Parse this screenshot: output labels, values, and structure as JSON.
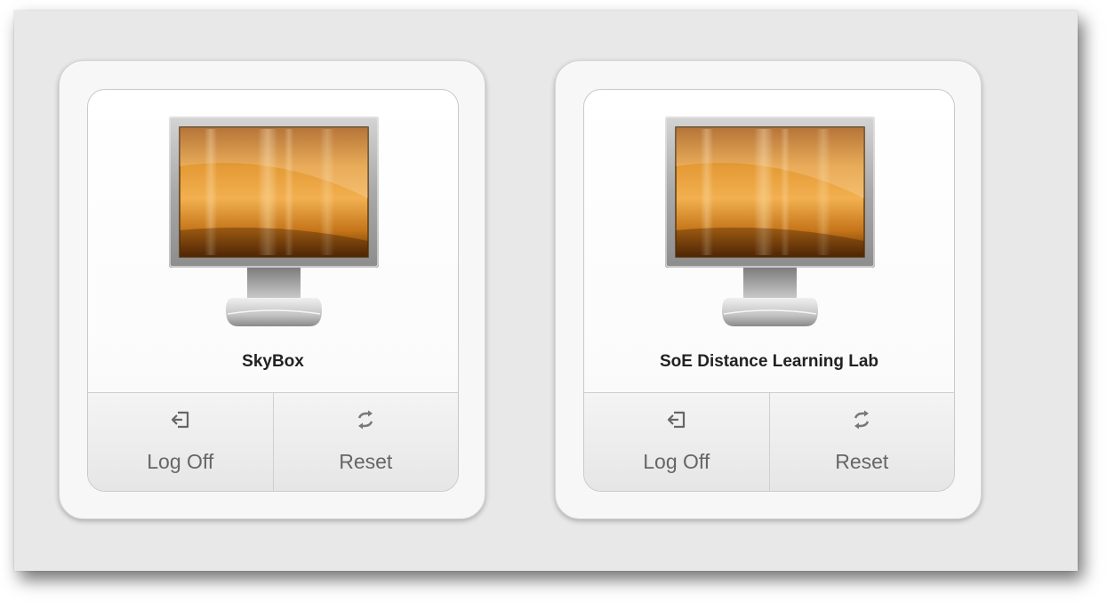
{
  "desktops": [
    {
      "name": "SkyBox",
      "icon": "monitor-icon",
      "actions": [
        {
          "label": "Log Off",
          "icon": "log-off-icon"
        },
        {
          "label": "Reset",
          "icon": "reset-icon"
        }
      ]
    },
    {
      "name": "SoE Distance Learning Lab",
      "icon": "monitor-icon",
      "actions": [
        {
          "label": "Log Off",
          "icon": "log-off-icon"
        },
        {
          "label": "Reset",
          "icon": "reset-icon"
        }
      ]
    }
  ],
  "colors": {
    "background": "#e8e8e8",
    "screen_orange": "#d6861a",
    "label_gray": "#666666"
  }
}
